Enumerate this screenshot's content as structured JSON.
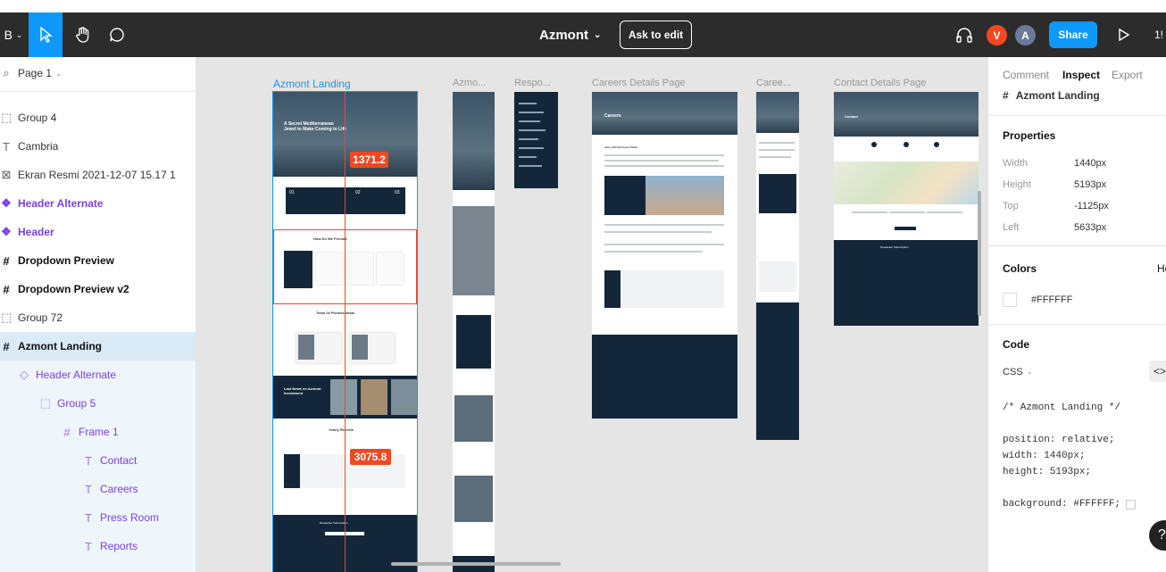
{
  "app": {
    "file_title": "Azmont",
    "ask_to_edit": "Ask to edit",
    "share": "Share",
    "zoom_partial": "1!",
    "avatars": [
      {
        "letter": "V",
        "color": "#f24822"
      },
      {
        "letter": "A",
        "color": "#6b7a99"
      }
    ]
  },
  "toolbar": {
    "menu_partial": "B",
    "icons": [
      "move-icon",
      "hand-icon",
      "comment-icon",
      "headphones-icon",
      "play-icon"
    ]
  },
  "layers": {
    "page_label": "Page 1",
    "items": [
      {
        "name": "Group 4",
        "type": "group"
      },
      {
        "name": "Cambria",
        "type": "text"
      },
      {
        "name": "Ekran Resmi 2021-12-07 15.17 1",
        "type": "image"
      },
      {
        "name": "Header Alternate",
        "type": "component"
      },
      {
        "name": "Header",
        "type": "component"
      },
      {
        "name": "Dropdown Preview",
        "type": "frame"
      },
      {
        "name": "Dropdown Preview v2",
        "type": "frame"
      },
      {
        "name": "Group 72",
        "type": "group"
      },
      {
        "name": "Azmont Landing",
        "type": "frame",
        "selected": true
      },
      {
        "name": "Header Alternate",
        "type": "instance"
      },
      {
        "name": "Group 5",
        "type": "group"
      },
      {
        "name": "Frame 1",
        "type": "frame"
      },
      {
        "name": "Contact",
        "type": "text"
      },
      {
        "name": "Careers",
        "type": "text"
      },
      {
        "name": "Press Room",
        "type": "text"
      },
      {
        "name": "Reports",
        "type": "text"
      }
    ]
  },
  "canvas": {
    "frames": [
      {
        "label": "Azmont Landing",
        "selected": true
      },
      {
        "label": "Azmo..."
      },
      {
        "label": "Respo..."
      },
      {
        "label": "Careers Details Page"
      },
      {
        "label": "Caree..."
      },
      {
        "label": "Contact Details Page"
      }
    ],
    "measure_top": "1371.2",
    "measure_bottom": "3075.8",
    "landing": {
      "hero_text": "A Secret Mediterranean Jewel to Make Coming to Life",
      "services_title": "How Do We Provide",
      "team_title": "Team Of Professionals",
      "news_title": "Last News on Azmont Investment",
      "reports_title": "Yearly Reports",
      "newsletter_title": "Newsletter Subscription",
      "card_labels": [
        "01",
        "02",
        "03"
      ]
    },
    "careers": {
      "heading": "Careers",
      "job_title": "Jobs with Portonovi Team"
    },
    "contact": {
      "heading": "Contact",
      "newsletter": "Newsletter Subscription"
    }
  },
  "inspect": {
    "tabs": [
      "Comment",
      "Inspect",
      "Export"
    ],
    "active_tab": "Inspect",
    "selected_name": "Azmont Landing",
    "properties_title": "Properties",
    "properties": [
      {
        "label": "Width",
        "value": "1440px"
      },
      {
        "label": "Height",
        "value": "5193px"
      },
      {
        "label": "Top",
        "value": "-1125px"
      },
      {
        "label": "Left",
        "value": "5633px"
      }
    ],
    "colors_title": "Colors",
    "colors_extra": "He",
    "color_value": "#FFFFFF",
    "code_title": "Code",
    "code_lang": "CSS",
    "code_lines": [
      "/* Azmont Landing */",
      "",
      "position: relative;",
      "width: 1440px;",
      "height: 5193px;",
      "",
      "background: #FFFFFF;"
    ]
  },
  "colors": {
    "accent": "#0d99ff",
    "component": "#7b3fe4",
    "measure": "#f24822",
    "topbar": "#2c2c2c",
    "navy": "#14273a"
  }
}
